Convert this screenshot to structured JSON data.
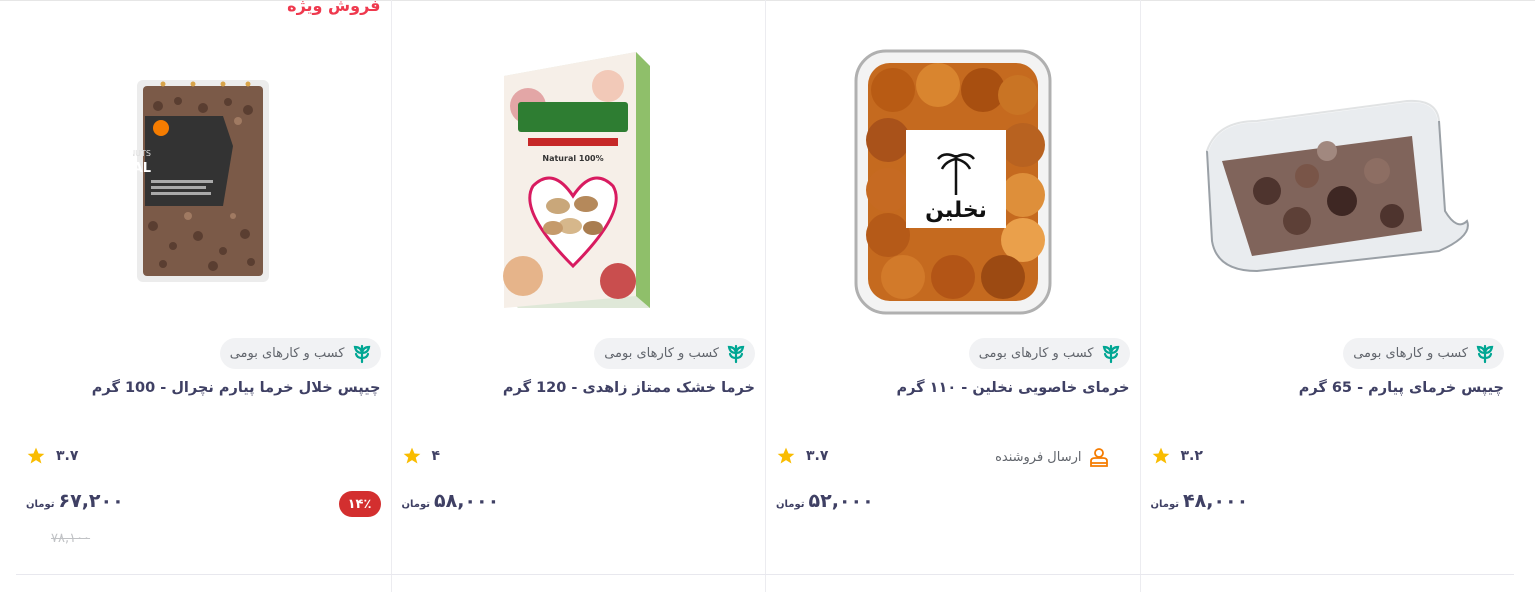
{
  "products": [
    {
      "special_label": "",
      "image": "date-chips-clear-box",
      "badge": "کسب و کارهای بومی",
      "title": "چیپس خرمای پیارم - 65 گرم",
      "shipping": "",
      "rating": "۳.۲",
      "price": "۴۸,۰۰۰",
      "currency": "تومان",
      "discount": "",
      "old_price": ""
    },
    {
      "special_label": "",
      "image": "nakhlin-dates-box",
      "badge": "کسب و کارهای بومی",
      "title": "خرمای خاصویی نخلین - ۱۱۰ گرم",
      "shipping": "ارسال فروشنده",
      "rating": "۳.۷",
      "price": "۵۲,۰۰۰",
      "currency": "تومان",
      "discount": "",
      "old_price": "",
      "package_label": "نخلین"
    },
    {
      "special_label": "",
      "image": "zahedi-dates-gift-box",
      "badge": "کسب و کارهای بومی",
      "title": "خرما خشک ممتاز زاهدی - 120 گرم",
      "shipping": "",
      "rating": "۴",
      "price": "۵۸,۰۰۰",
      "currency": "تومان",
      "discount": "",
      "old_price": "",
      "package_label": "100% Natural"
    },
    {
      "special_label": "فروش ویژه",
      "image": "natural-chips-bag",
      "badge": "کسب و کارهای بومی",
      "title": "چیپس خلال خرما پیارم نچرال - 100 گرم",
      "shipping": "",
      "rating": "۳.۷",
      "price": "۶۷,۲۰۰",
      "currency": "تومان",
      "discount": "۱۴٪",
      "old_price": "۷۸,۱۰۰",
      "package_label": "NATURAL"
    }
  ],
  "colors": {
    "accent_red": "#ef394e",
    "discount_red": "#d32f2f",
    "star": "#f9bc00",
    "local_business_green": "#00a693",
    "shipping_orange": "#f57c00"
  }
}
